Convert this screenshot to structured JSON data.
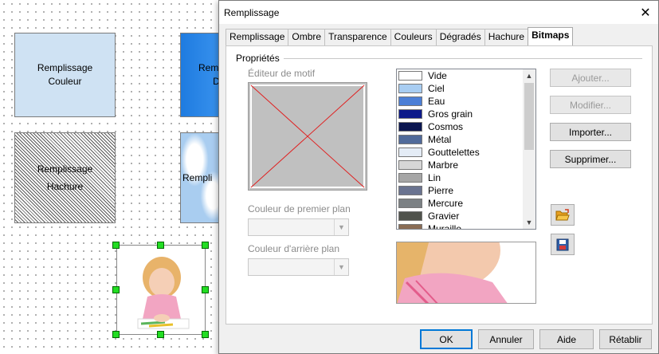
{
  "canvas": {
    "shape_couleur": {
      "line1": "Remplissage",
      "line2": "Couleur"
    },
    "shape_degrade": {
      "line1": "Remp",
      "line2": "D"
    },
    "shape_hachure": {
      "line1": "Remplissage",
      "line2": "Hachure"
    },
    "shape_bitmap": {
      "line1": "Rempli"
    }
  },
  "dialog": {
    "title": "Remplissage",
    "close_glyph": "✕",
    "tabs": [
      "Remplissage",
      "Ombre",
      "Transparence",
      "Couleurs",
      "Dégradés",
      "Hachure",
      "Bitmaps"
    ],
    "active_tab": "Bitmaps",
    "section_label": "Propriétés",
    "pattern_editor_label": "Éditeur de motif",
    "foreground_label": "Couleur de premier plan",
    "background_label": "Couleur d'arrière plan",
    "bitmap_list": [
      {
        "name": "Vide",
        "color": "#ffffff"
      },
      {
        "name": "Ciel",
        "color": "#a8cdf2"
      },
      {
        "name": "Eau",
        "color": "#4c7fd6"
      },
      {
        "name": "Gros grain",
        "color": "#0d1a8a"
      },
      {
        "name": "Cosmos",
        "color": "#0b1650"
      },
      {
        "name": "Métal",
        "color": "#506a9a"
      },
      {
        "name": "Gouttelettes",
        "color": "#e4ecf6"
      },
      {
        "name": "Marbre",
        "color": "#d6d6d6"
      },
      {
        "name": "Lin",
        "color": "#a6a6a6"
      },
      {
        "name": "Pierre",
        "color": "#6a7390"
      },
      {
        "name": "Mercure",
        "color": "#7c8184"
      },
      {
        "name": "Gravier",
        "color": "#50534c"
      },
      {
        "name": "Muraille",
        "color": "#8a6d55"
      }
    ],
    "buttons": {
      "add": "Ajouter...",
      "modify": "Modifier...",
      "import": "Importer...",
      "delete": "Supprimer..."
    },
    "footer": {
      "ok": "OK",
      "cancel": "Annuler",
      "help": "Aide",
      "reset": "Rétablir"
    }
  }
}
